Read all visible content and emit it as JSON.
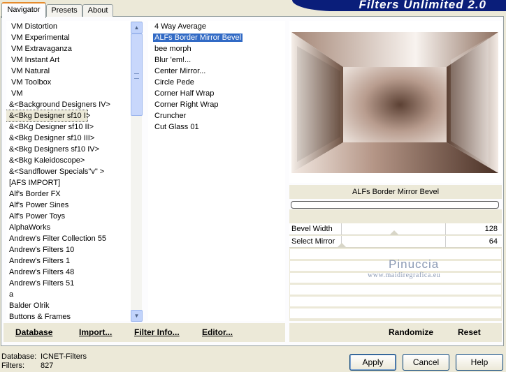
{
  "tabs": [
    {
      "label": "Navigator",
      "active": true
    },
    {
      "label": "Presets",
      "active": false
    },
    {
      "label": "About",
      "active": false
    }
  ],
  "app_title": "Filters Unlimited 2.0",
  "categories": [
    "VM Distortion",
    "VM Experimental",
    "VM Extravaganza",
    "VM Instant Art",
    "VM Natural",
    "VM Toolbox",
    "VM",
    "&<Background Designers IV>",
    "&<Bkg Designer sf10 I>",
    "&<BKg Designer sf10 II>",
    "&<Bkg Designer sf10 III>",
    "&<Bkg Designers sf10 IV>",
    "&<Bkg Kaleidoscope>",
    "&<Sandflower Specials\"v\" >",
    "[AFS IMPORT]",
    "Alf's Border FX",
    "Alf's Power Sines",
    "Alf's Power Toys",
    "AlphaWorks",
    "Andrew's Filter Collection 55",
    "Andrew's Filters 10",
    "Andrew's Filters 1",
    "Andrew's Filters 48",
    "Andrew's Filters 51",
    "a",
    "Balder Olrik",
    "Buttons & Frames"
  ],
  "selected_category_index": 8,
  "filters": [
    "4 Way Average",
    "ALFs Border Mirror Bevel",
    "bee morph",
    "Blur 'em!...",
    "Center Mirror...",
    "Circle Pede",
    "Corner Half Wrap",
    "Corner Right Wrap",
    "Cruncher",
    "Cut Glass  01"
  ],
  "selected_filter_index": 1,
  "left_buttons": {
    "database": "Database",
    "import": "Import...",
    "filter_info": "Filter Info...",
    "editor": "Editor..."
  },
  "right_buttons": {
    "randomize": "Randomize",
    "reset": "Reset"
  },
  "filter_name": "ALFs Border Mirror Bevel",
  "params": [
    {
      "label": "Bevel Width",
      "value": "128",
      "fraction": 0.5
    },
    {
      "label": "Select Mirror",
      "value": "64",
      "fraction": 0.0
    }
  ],
  "watermark": {
    "name": "Pinuccia",
    "site": "www.maidiregrafica.eu"
  },
  "status": {
    "database_label": "Database:",
    "database_value": "ICNET-Filters",
    "filters_label": "Filters:",
    "filters_value": "827"
  },
  "dialog_buttons": {
    "apply": "Apply",
    "cancel": "Cancel",
    "help": "Help"
  },
  "colors": {
    "selection": "#316ac5",
    "title_bar": "#0a1e7a",
    "tab_accent": "#e68b2c",
    "preview_tone": "#8a6a58"
  }
}
